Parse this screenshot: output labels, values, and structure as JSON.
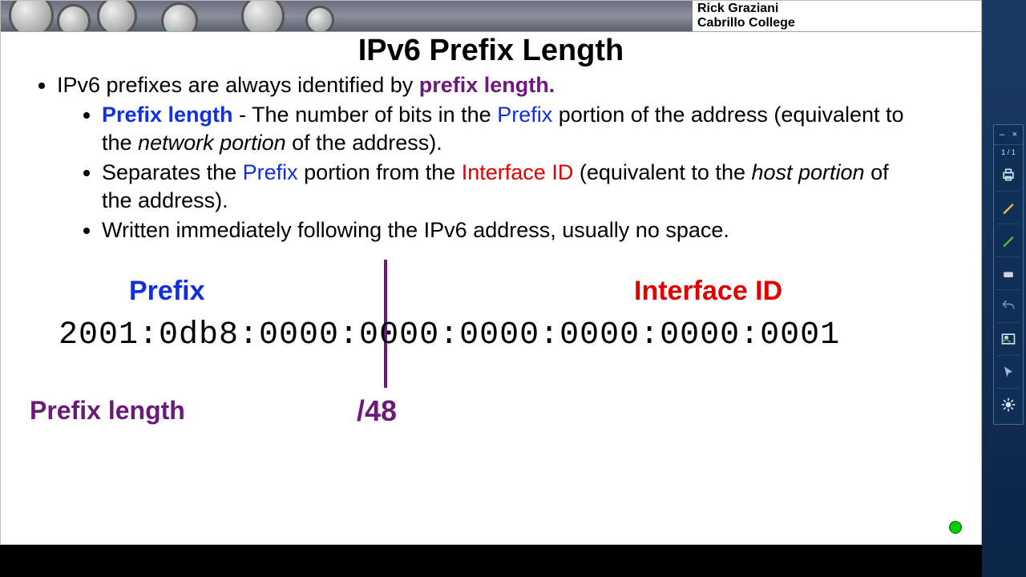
{
  "attribution": {
    "line1": "Rick Graziani",
    "line2": "Cabrillo College"
  },
  "title": "IPv6 Prefix Length",
  "bullets": {
    "b1a": "IPv6 prefixes are always identified by ",
    "b1b": "prefix length.",
    "s1a": "Prefix length",
    "s1b": " - The number of bits in the ",
    "s1c": "Prefix",
    "s1d": " portion of the address (equivalent to the ",
    "s1e": "network portion",
    "s1f": " of the address).",
    "s2a": "Separates the ",
    "s2b": "Prefix",
    "s2c": " portion from the ",
    "s2d": "Interface ID",
    "s2e": " (equivalent to the ",
    "s2f": "host portion",
    "s2g": " of the address).",
    "s3": "Written immediately following the IPv6 address, usually no space."
  },
  "diagram": {
    "prefix_label": "Prefix",
    "interface_label": "Interface ID",
    "address": "2001:0db8:0000:0000:0000:0000:0000:0001",
    "prefix_length_label": "Prefix length",
    "prefix_length_value": "/48"
  },
  "toolbar": {
    "page": "1 / 1",
    "minimize": "–",
    "close": "×"
  }
}
